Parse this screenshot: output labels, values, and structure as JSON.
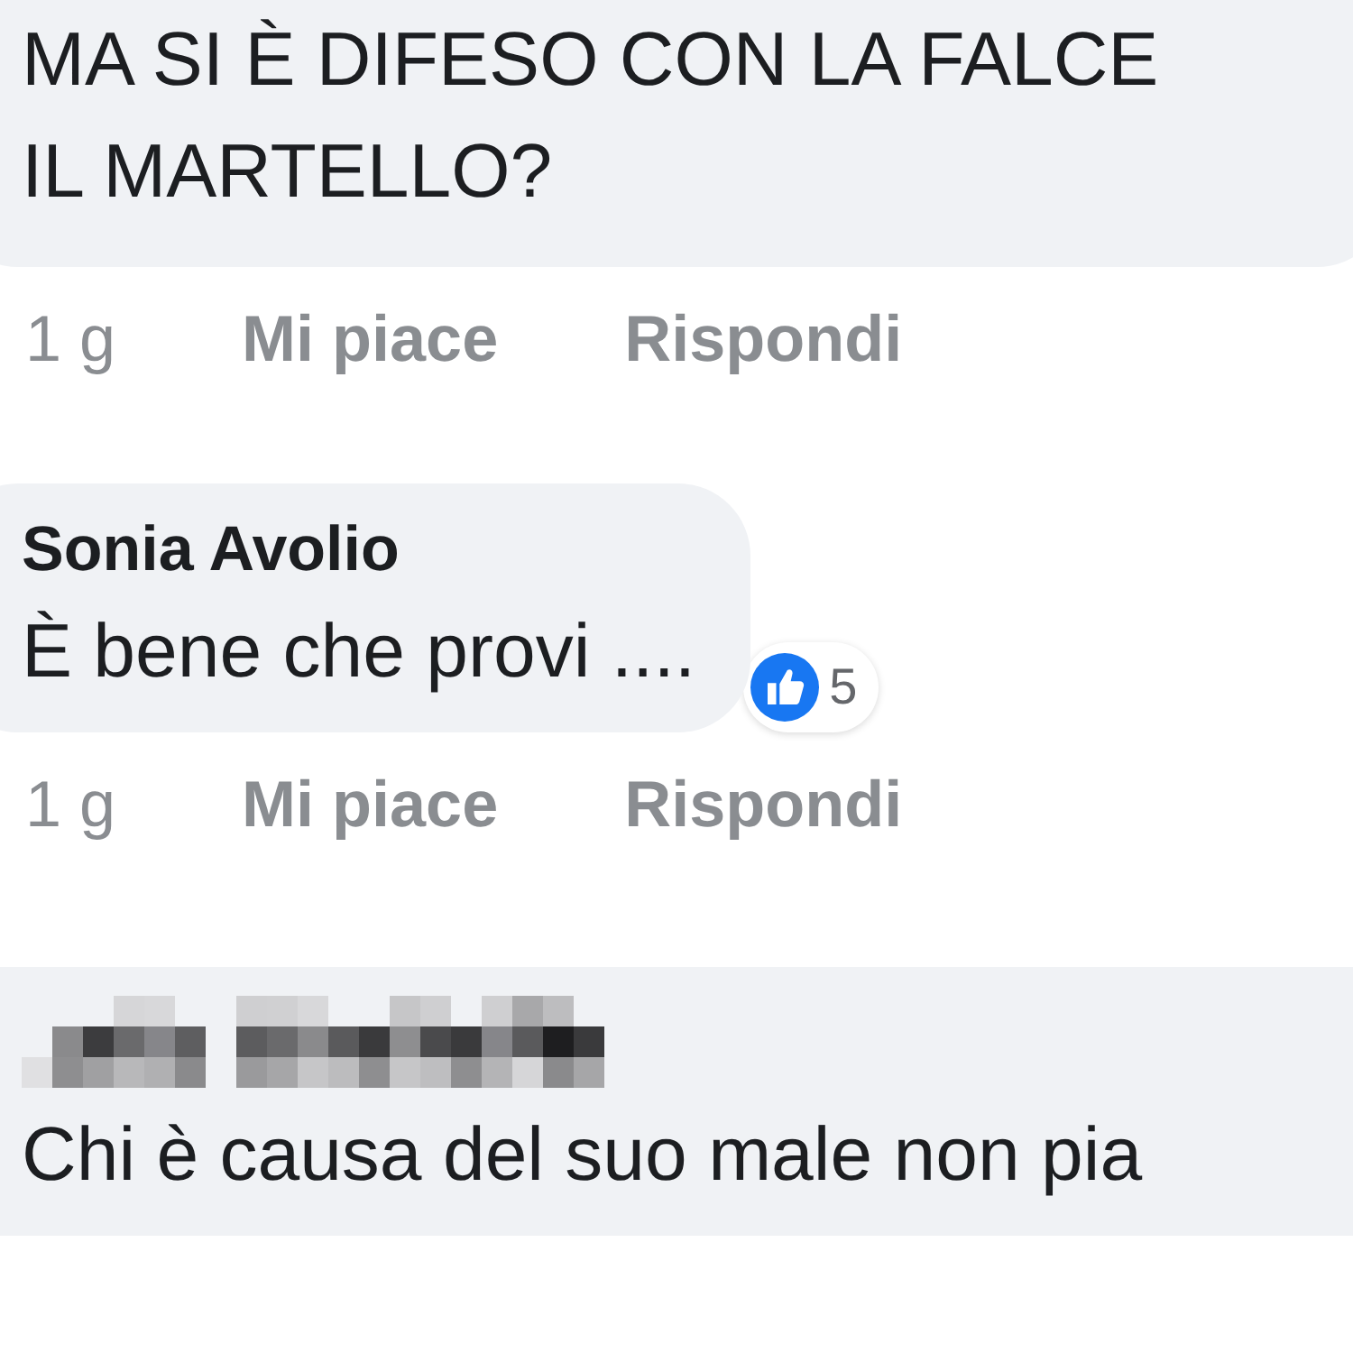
{
  "comments": [
    {
      "author_blurred": false,
      "lines": [
        "MA SI È DIFESO CON LA FALCE",
        "IL MARTELLO?"
      ],
      "time": "1 g",
      "like": "Mi piace",
      "reply": "Rispondi"
    },
    {
      "author": "Sonia Avolio",
      "author_blurred": false,
      "lines": [
        "È  bene che provi ...."
      ],
      "reaction": {
        "kind": "like",
        "count": "5"
      },
      "time": "1 g",
      "like": "Mi piace",
      "reply": "Rispondi"
    },
    {
      "author_blurred": true,
      "lines": [
        "Chi è causa del suo male non pia"
      ]
    }
  ]
}
